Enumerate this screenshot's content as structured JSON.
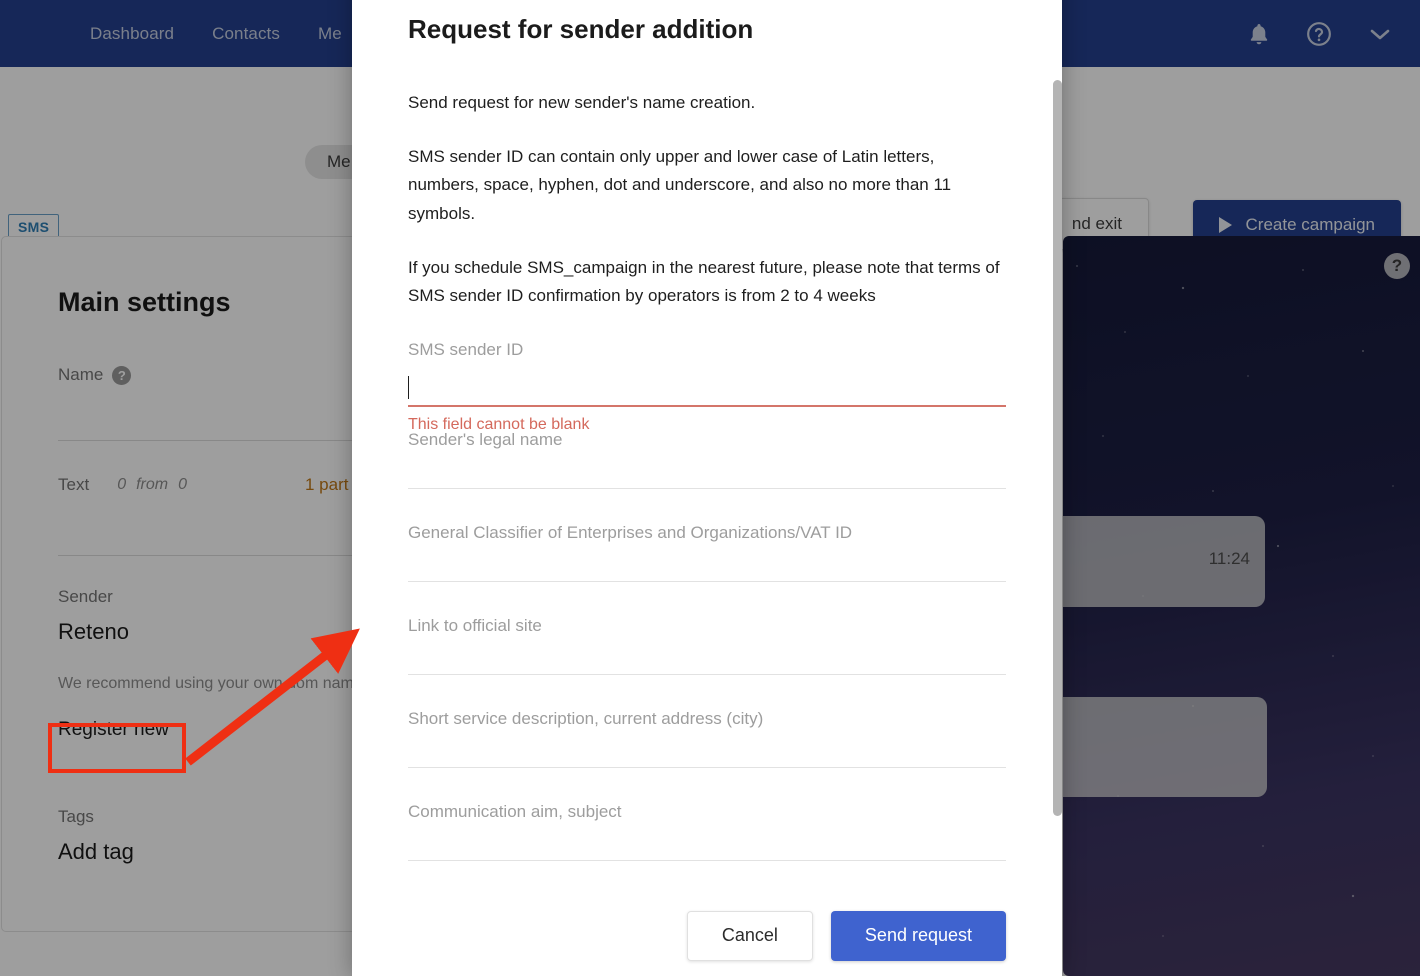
{
  "topnav": {
    "links": [
      {
        "label": "Dashboard",
        "name": "nav-dashboard"
      },
      {
        "label": "Contacts",
        "name": "nav-contacts"
      },
      {
        "label": "Me",
        "name": "nav-messages"
      }
    ],
    "icons": {
      "bell": "bell-icon",
      "help": "help-circle-icon",
      "chevron": "chevron-down-icon"
    }
  },
  "subbar": {
    "breadcrumb_pill": "Me",
    "channel_tag": "SMS",
    "save_exit_label": "nd exit",
    "create_campaign_label": "Create campaign"
  },
  "settings": {
    "title": "Main settings",
    "name_label": "Name",
    "text_label": "Text",
    "text_count_current": "0",
    "text_count_from": "from",
    "text_count_total": "0",
    "parts_label": "1 part",
    "sender_label": "Sender",
    "sender_value": "Reteno",
    "sender_note": "We recommend using your own dom name can be changed by the operat",
    "register_new_label": "Register new",
    "tags_label": "Tags",
    "add_tag_label": "Add tag",
    "help_glyph": "?"
  },
  "preview": {
    "help_glyph": "?",
    "message_time": "11:24"
  },
  "modal": {
    "title": "Request for sender addition",
    "paragraphs": [
      "Send request for new sender's name creation.",
      "SMS sender ID can contain only upper and lower case of Latin letters, numbers, space, hyphen, dot and underscore, and also no more than 11 symbols.",
      "If you schedule SMS_campaign in the nearest future, please note that terms of SMS sender ID confirmation by operators is from 2 to 4 weeks"
    ],
    "fields": [
      {
        "name": "sms-sender-id",
        "label": "SMS sender ID",
        "value": "",
        "placeholder": "",
        "error": "This field cannot be blank"
      },
      {
        "name": "senders-legal-name",
        "label": "",
        "value": "",
        "placeholder": "Sender's legal name",
        "error": ""
      },
      {
        "name": "vat-id",
        "label": "",
        "value": "",
        "placeholder": "General Classifier of Enterprises and Organizations/VAT ID",
        "error": ""
      },
      {
        "name": "official-site-link",
        "label": "",
        "value": "",
        "placeholder": "Link to official site",
        "error": ""
      },
      {
        "name": "service-description",
        "label": "",
        "value": "",
        "placeholder": "Short service description, current address (city)",
        "error": ""
      },
      {
        "name": "communication-aim",
        "label": "",
        "value": "",
        "placeholder": "Communication aim, subject",
        "error": ""
      }
    ],
    "cancel_label": "Cancel",
    "send_label": "Send request"
  },
  "colors": {
    "nav_blue": "#24408e",
    "primary_button_blue": "#3f63cf",
    "error_red": "#d4695c",
    "annotation_red": "#ef2f13",
    "amber": "#c07818",
    "tag_blue": "#2f7fb5"
  }
}
